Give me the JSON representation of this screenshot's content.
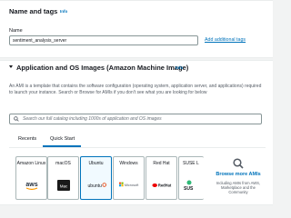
{
  "name_section": {
    "title": "Name and tags",
    "info": "Info",
    "name_label": "Name",
    "name_value": "sentiment_analysis_server",
    "add_tags_link": "Add additional tags"
  },
  "ami_section": {
    "title": "Application and OS Images (Amazon Machine Image)",
    "info": "Info",
    "description": "An AMI is a template that contains the software configuration (operating system, application server, and applications) required to launch your instance. Search or Browse for AMIs if you don't see what you are looking for below",
    "search_placeholder": "Search our full catalog including 1000s of application and OS images",
    "tabs": [
      {
        "label": "Recents",
        "active": false
      },
      {
        "label": "Quick Start",
        "active": true
      }
    ],
    "os_cards": [
      {
        "name": "Amazon Linux",
        "logo": "aws",
        "selected": false
      },
      {
        "name": "macOS",
        "logo": "Mac",
        "selected": false
      },
      {
        "name": "Ubuntu",
        "logo": "ubuntu",
        "selected": true
      },
      {
        "name": "Windows",
        "logo": "Microsoft",
        "selected": false
      },
      {
        "name": "Red Hat",
        "logo": "RedHat",
        "selected": false
      },
      {
        "name": "SUSE L",
        "logo": "SUS",
        "selected": false
      }
    ],
    "browse": {
      "title": "Browse more AMIs",
      "subtitle": "Including AMIs from AWS, Marketplace and the Community"
    }
  },
  "colors": {
    "accent": "#0073bb",
    "selected_card_bg": "#f1faff",
    "page_bg": "#f2f3f3"
  }
}
